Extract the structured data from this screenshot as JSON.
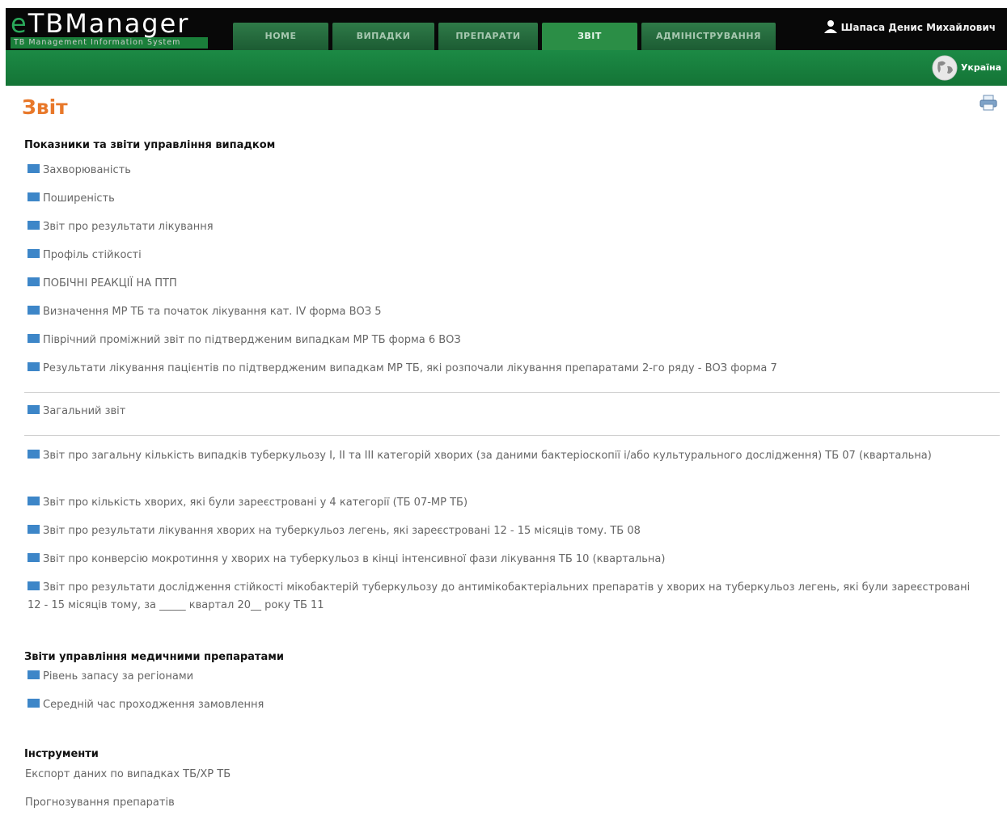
{
  "app": {
    "logo_title": "TBManager",
    "logo_prefix": "e",
    "logo_subtitle": "TB Management Information System",
    "brand_color": "#1a7f3a",
    "accent_color": "#e8782a"
  },
  "nav": {
    "tabs": [
      {
        "label": "HOME"
      },
      {
        "label": "ВИПАДКИ"
      },
      {
        "label": "ПРЕПАРАТИ"
      },
      {
        "label": "ЗВІТ",
        "active": true
      },
      {
        "label": "АДМІНІСТРУВАННЯ"
      }
    ]
  },
  "user": {
    "name": "Шапаса Денис Михайлович",
    "icon": "user-icon"
  },
  "country": {
    "name": "Україна",
    "icon": "globe-icon"
  },
  "page": {
    "title": "Звіт",
    "print_icon": "printer-icon"
  },
  "sections": {
    "case_management": {
      "heading": "Показники та звіти управління випадком",
      "links": [
        "Захворюваність",
        "Поширеність",
        "Звіт про результати лікування",
        "Профіль стійкості",
        "ПОБІЧНІ РЕАКЦІЇ НА ПТП",
        "Визначення МР ТБ та початок лікування кат. IV форма ВОЗ 5",
        "Піврічний проміжний звіт по підтвердженим випадкам МР ТБ форма 6 ВОЗ",
        "Результати лікування пацієнтів по підтвердженим випадкам МР ТБ, які розпочали лікування препаратами 2-го ряду - ВОЗ форма 7"
      ]
    },
    "general": {
      "links": [
        "Загальний звіт"
      ]
    },
    "tb_reports": {
      "links": [
        "Звіт про загальну кількість випадків туберкульозу I, II та III категорій хворих (за даними бактеріоскопії і/або культурального дослідження) ТБ 07 (квартальна)",
        "Звіт про кількість хворих, які були зареєстровані у 4 категорії (ТБ 07-МР ТБ)",
        "Звіт про результати лікування хворих на туберкульоз легень, які зареєстровані 12 - 15 місяців тому. ТБ 08",
        "Звіт про конверсію мокротиння у хворих на туберкульоз в кінці інтенсивної фази лікування ТБ 10 (квартальна)",
        "Звіт про результати дослідження стійкості мікобактерій туберкульозу до антимікобактеріальних препаратів у хворих на туберкульоз легень, які були зареєстровані 12 - 15 місяців тому, за _____ квартал 20__ року ТБ 11"
      ]
    },
    "drug_management": {
      "heading": "Звіти управління медичними препаратами",
      "links": [
        "Рівень запасу за регіонами",
        "Середній час проходження замовлення"
      ]
    },
    "tools": {
      "heading": "Інструменти",
      "links": [
        "Експорт даних по випадках ТБ/ХР ТБ",
        "Прогнозування препаратів"
      ]
    }
  }
}
